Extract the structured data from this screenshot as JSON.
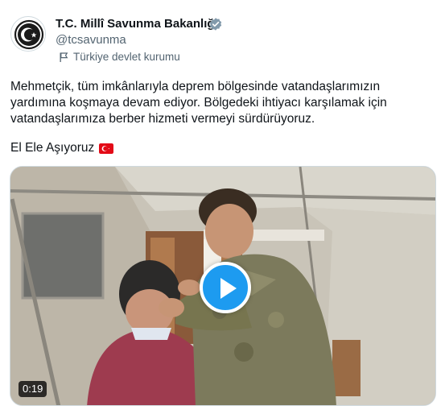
{
  "author": {
    "name": "T.C. Millî Savunma Bakanlığı",
    "handle": "@tcsavunma",
    "affiliation": "Türkiye devlet kurumu",
    "verified_color": "#829aab"
  },
  "tweet": {
    "text": "Mehmetçik, tüm imkânlarıyla deprem bölgesinde vatandaşlarımızın yardımına koşmaya devam ediyor. Bölgedeki ihtiyacı karşılamak için vatandaşlarımıza berber hizmeti vermeyi sürdürüyoruz.",
    "hashline": "El Ele Aşıyoruz",
    "flag_icon": "turkey-flag-icon"
  },
  "media": {
    "duration": "0:19",
    "play_color": "#1d9bf0"
  }
}
